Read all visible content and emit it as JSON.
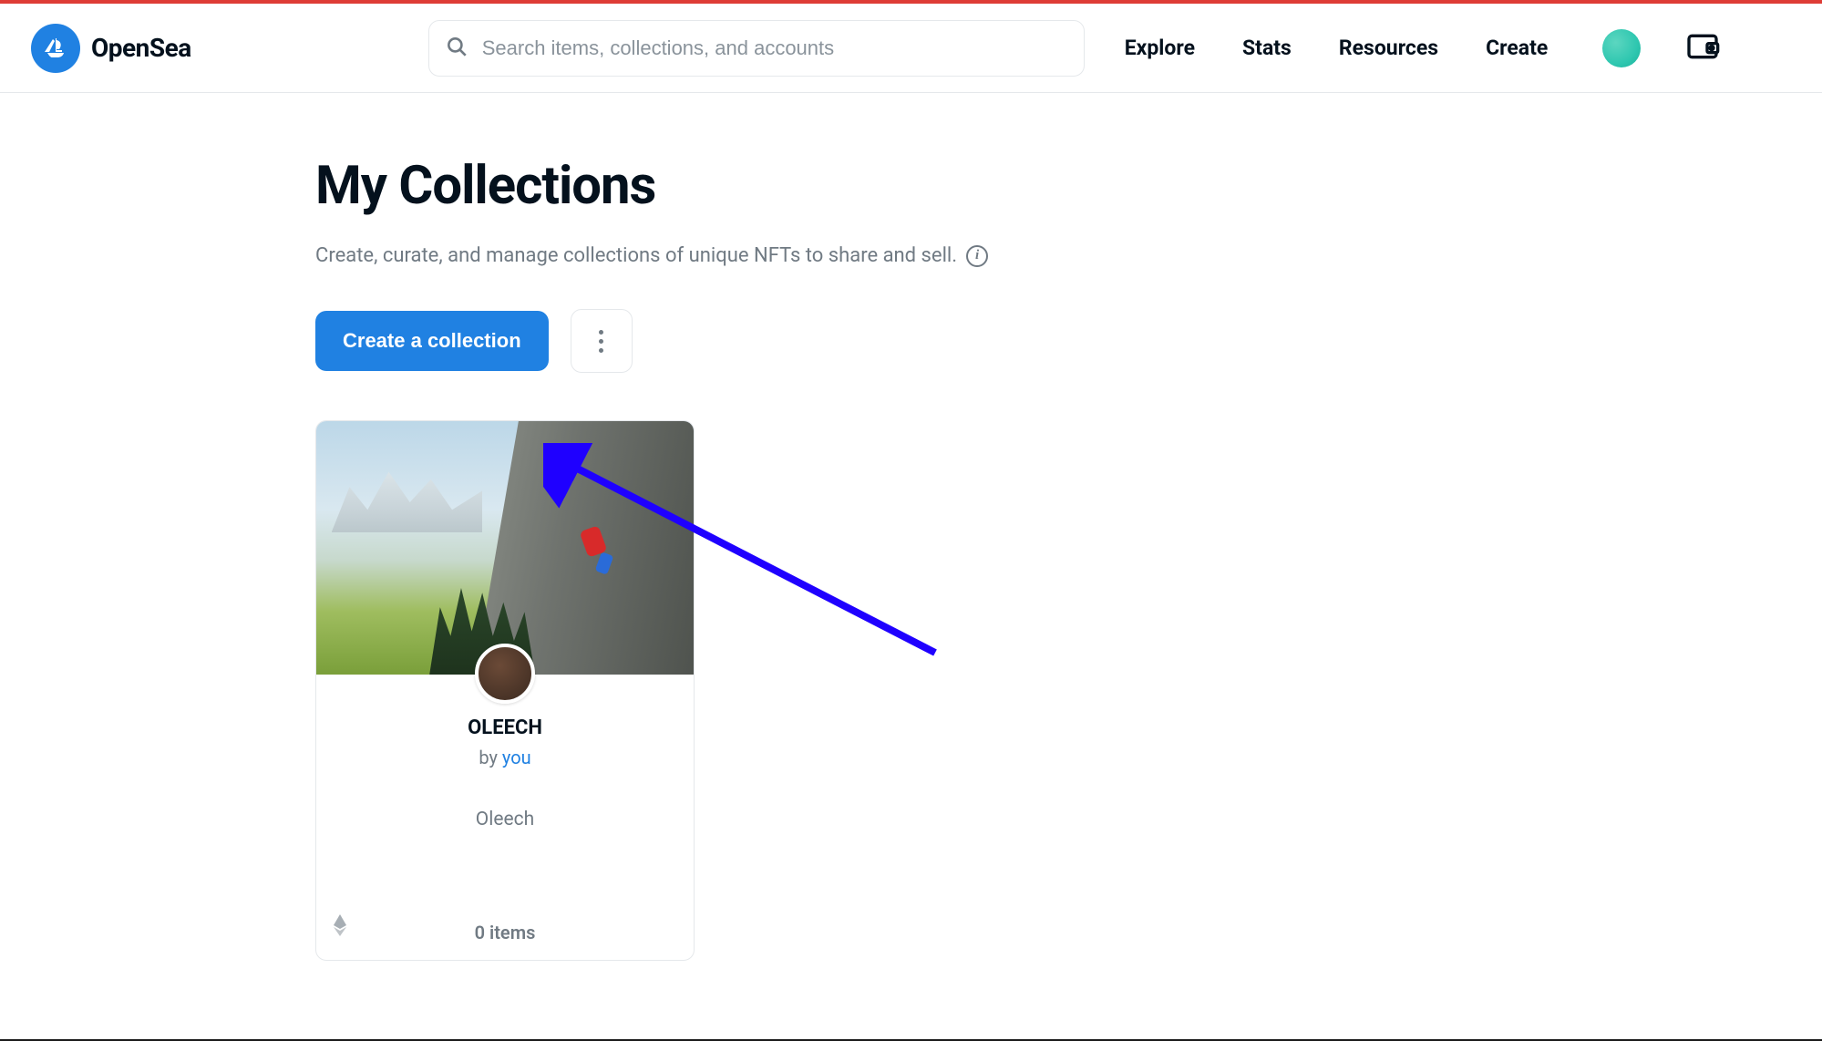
{
  "brand": {
    "name": "OpenSea"
  },
  "search": {
    "placeholder": "Search items, collections, and accounts"
  },
  "nav": {
    "explore": "Explore",
    "stats": "Stats",
    "resources": "Resources",
    "create": "Create"
  },
  "page": {
    "title": "My Collections",
    "subtitle": "Create, curate, and manage collections of unique NFTs to share and sell."
  },
  "actions": {
    "create_collection": "Create a collection"
  },
  "collections": [
    {
      "name": "OLEECH",
      "by_prefix": "by ",
      "by_link": "you",
      "description": "Oleech",
      "item_count_text": "0 items"
    }
  ],
  "colors": {
    "primary": "#2081e2",
    "text": "#04111d",
    "muted": "#707a83",
    "border": "#e5e8eb",
    "annotation": "#1f00ff"
  }
}
